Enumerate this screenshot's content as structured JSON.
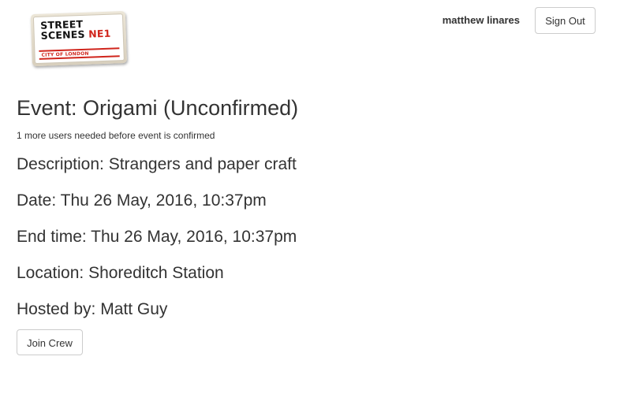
{
  "logo": {
    "line1": "STREET",
    "line2_main": "SCENES",
    "line2_code": "NE1",
    "subtitle": "CITY OF LONDON"
  },
  "header": {
    "username": "matthew linares",
    "sign_out_label": "Sign Out"
  },
  "event": {
    "title": "Event: Origami (Unconfirmed)",
    "confirmation_note": "1 more users needed before event is confirmed",
    "description": "Description: Strangers and paper craft",
    "date": "Date: Thu 26 May, 2016, 10:37pm",
    "end_time": "End time: Thu 26 May, 2016, 10:37pm",
    "location": "Location: Shoreditch Station",
    "hosted_by": "Hosted by: Matt Guy",
    "join_label": "Join Crew"
  },
  "colors": {
    "sign_red": "#d0251c",
    "text": "#333333",
    "button_border": "#cccccc"
  }
}
